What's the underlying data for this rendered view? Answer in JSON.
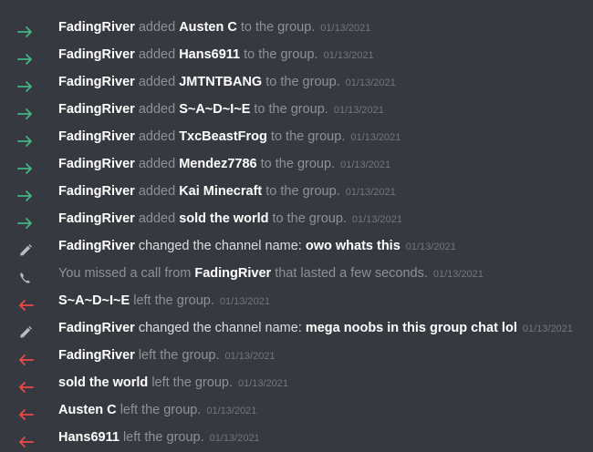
{
  "colors": {
    "join_arrow": "#43b581",
    "leave_arrow": "#f04747",
    "neutral_icon": "#b9bbbe",
    "background": "#36393f"
  },
  "messages": [
    {
      "type": "join",
      "icon": "arrow-right-icon",
      "actor": "FadingRiver",
      "verb": "added",
      "target": "Austen C",
      "suffix": "to the group.",
      "time": "01/13/2021"
    },
    {
      "type": "join",
      "icon": "arrow-right-icon",
      "actor": "FadingRiver",
      "verb": "added",
      "target": "Hans6911",
      "suffix": "to the group.",
      "time": "01/13/2021"
    },
    {
      "type": "join",
      "icon": "arrow-right-icon",
      "actor": "FadingRiver",
      "verb": "added",
      "target": "JMTNTBANG",
      "suffix": "to the group.",
      "time": "01/13/2021"
    },
    {
      "type": "join",
      "icon": "arrow-right-icon",
      "actor": "FadingRiver",
      "verb": "added",
      "target": "S~A~D~I~E",
      "suffix": "to the group.",
      "time": "01/13/2021"
    },
    {
      "type": "join",
      "icon": "arrow-right-icon",
      "actor": "FadingRiver",
      "verb": "added",
      "target": "TxcBeastFrog",
      "suffix": "to the group.",
      "time": "01/13/2021"
    },
    {
      "type": "join",
      "icon": "arrow-right-icon",
      "actor": "FadingRiver",
      "verb": "added",
      "target": "Mendez7786",
      "suffix": "to the group.",
      "time": "01/13/2021"
    },
    {
      "type": "join",
      "icon": "arrow-right-icon",
      "actor": "FadingRiver",
      "verb": "added",
      "target": "Kai Minecraft",
      "suffix": "to the group.",
      "time": "01/13/2021"
    },
    {
      "type": "join",
      "icon": "arrow-right-icon",
      "actor": "FadingRiver",
      "verb": "added",
      "target": "sold the world",
      "suffix": "to the group.",
      "time": "01/13/2021"
    },
    {
      "type": "rename",
      "icon": "pencil-icon",
      "actor": "FadingRiver",
      "verb": "changed the channel name:",
      "target": "owo whats this",
      "suffix": "",
      "time": "01/13/2021"
    },
    {
      "type": "call",
      "icon": "phone-icon",
      "actor": "",
      "verb": "You missed a call from",
      "target": "FadingRiver",
      "suffix": "that lasted a few seconds.",
      "time": "01/13/2021"
    },
    {
      "type": "leave",
      "icon": "arrow-left-icon",
      "actor": "S~A~D~I~E",
      "verb": "left the group.",
      "target": "",
      "suffix": "",
      "time": "01/13/2021"
    },
    {
      "type": "rename",
      "icon": "pencil-icon",
      "actor": "FadingRiver",
      "verb": "changed the channel name:",
      "target": "mega noobs in this group chat lol",
      "suffix": "",
      "time": "01/13/2021"
    },
    {
      "type": "leave",
      "icon": "arrow-left-icon",
      "actor": "FadingRiver",
      "verb": "left the group.",
      "target": "",
      "suffix": "",
      "time": "01/13/2021"
    },
    {
      "type": "leave",
      "icon": "arrow-left-icon",
      "actor": "sold the world",
      "verb": "left the group.",
      "target": "",
      "suffix": "",
      "time": "01/13/2021"
    },
    {
      "type": "leave",
      "icon": "arrow-left-icon",
      "actor": "Austen C",
      "verb": "left the group.",
      "target": "",
      "suffix": "",
      "time": "01/13/2021"
    },
    {
      "type": "leave",
      "icon": "arrow-left-icon",
      "actor": "Hans6911",
      "verb": "left the group.",
      "target": "",
      "suffix": "",
      "time": "01/13/2021"
    }
  ]
}
